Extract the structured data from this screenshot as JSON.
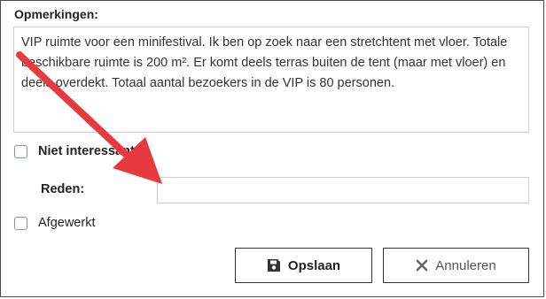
{
  "remarks": {
    "label": "Opmerkingen:",
    "text": "VIP ruimte voor een minifestival. Ik ben op zoek naar een stretchtent met vloer. Totale beschikbare ruimte is 200 m². Er komt deels terras buiten de tent (maar met vloer) en deels overdekt. Totaal aantal bezoekers in de VIP is 80 personen."
  },
  "not_interested": {
    "label": "Niet interessant",
    "checked": false
  },
  "reason": {
    "label": "Reden:",
    "value": ""
  },
  "finished": {
    "label": "Afgewerkt",
    "checked": false
  },
  "buttons": {
    "save": "Opslaan",
    "cancel": "Annuleren"
  },
  "icons": {
    "save": "floppy-disk-icon",
    "cancel": "x-icon"
  },
  "colors": {
    "annotation_arrow": "#e8393f",
    "border": "#cfcfcf"
  }
}
